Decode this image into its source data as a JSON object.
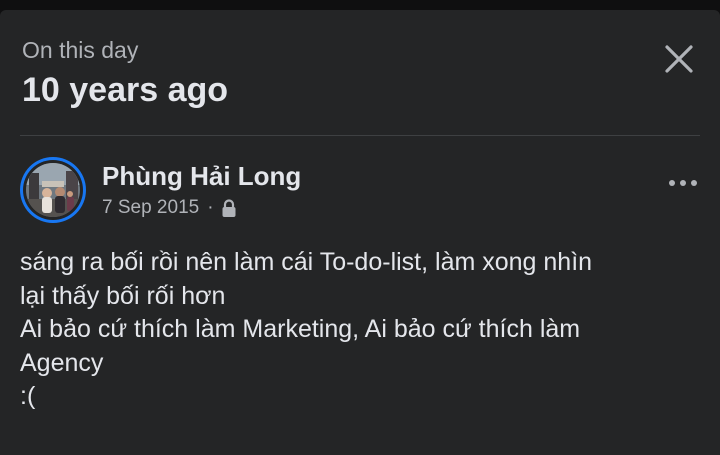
{
  "memory": {
    "subtitle": "On this day",
    "title": "10 years ago"
  },
  "post": {
    "author": "Phùng Hải Long",
    "date": "7 Sep 2015",
    "separator": "·",
    "privacy_icon": "lock-icon",
    "lines": [
      "sáng ra bối rồi nên làm cái To-do-list, làm xong nhìn",
      "lại thấy bối rối hơn",
      "Ai bảo cứ thích làm Marketing, Ai bảo cứ thích làm",
      "Agency",
      ":("
    ]
  },
  "icons": {
    "close": "close-icon",
    "more": "more-options-icon"
  },
  "colors": {
    "background": "#242526",
    "accent_ring": "#1877f2",
    "primary_text": "#e4e6eb",
    "secondary_text": "#b0b3b8"
  }
}
